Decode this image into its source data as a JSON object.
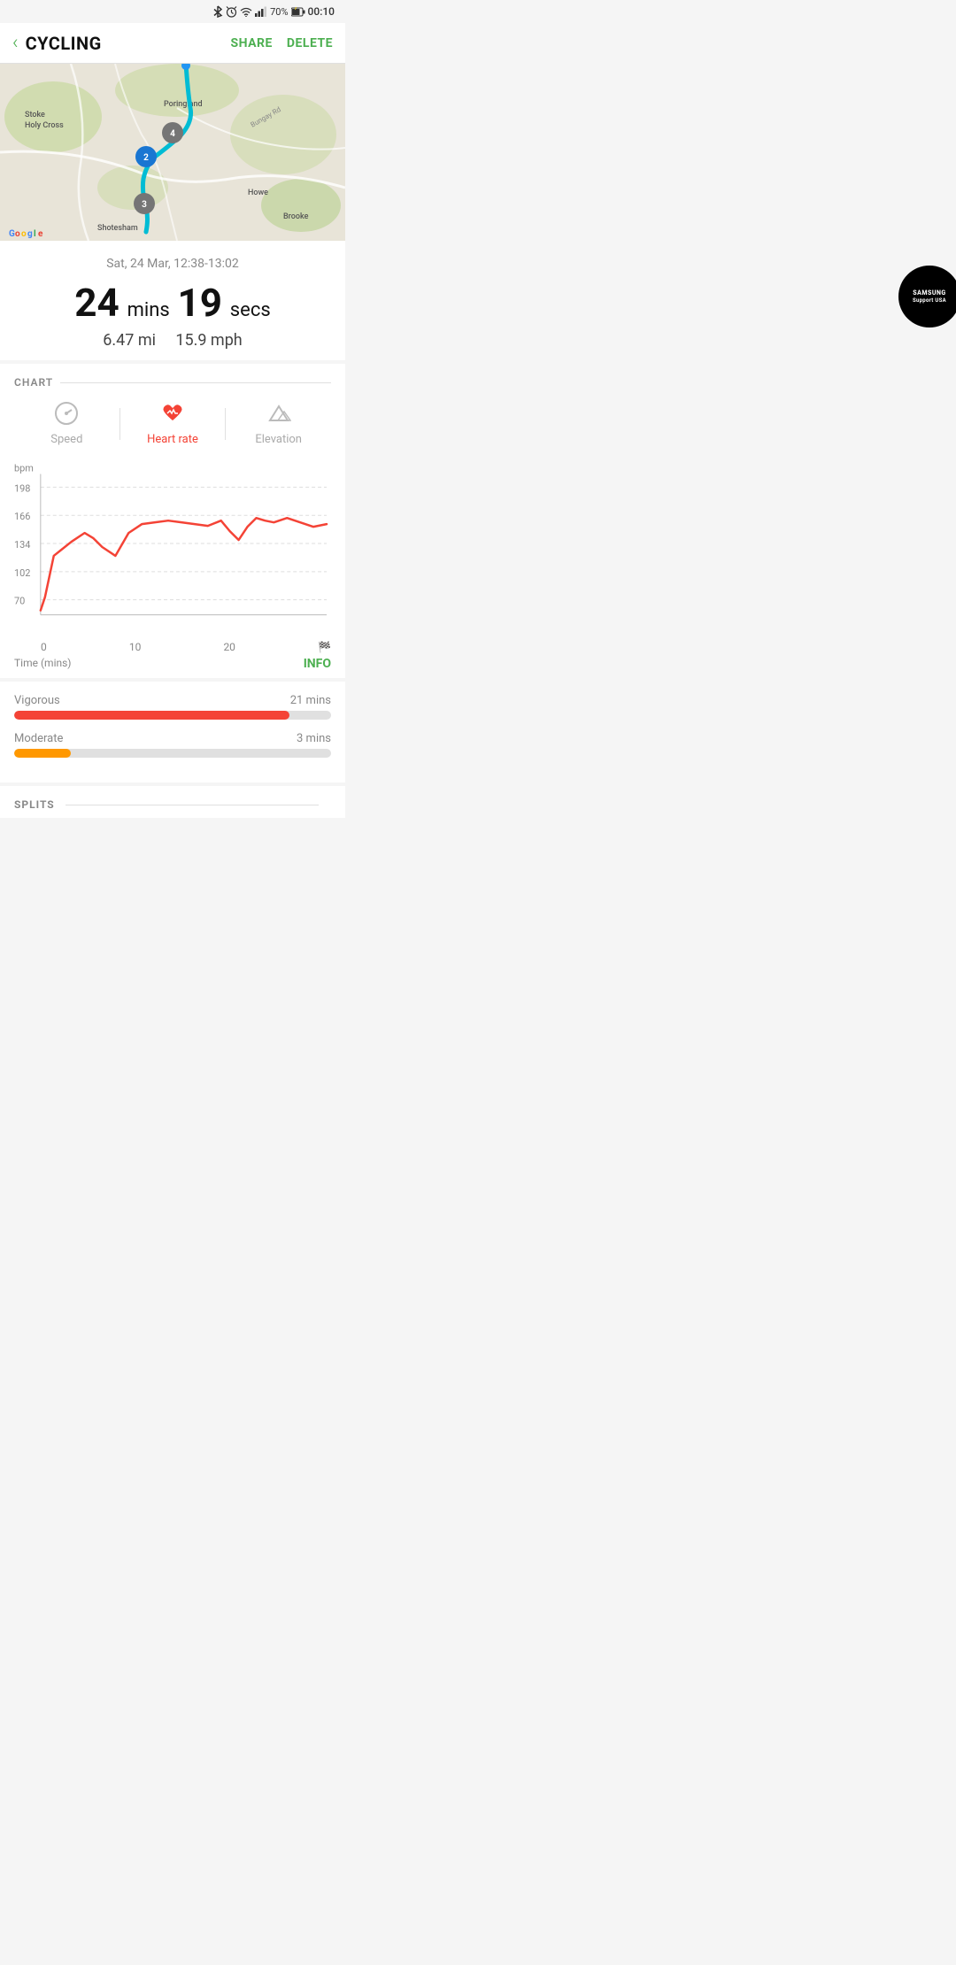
{
  "statusBar": {
    "time": "00:10",
    "battery": "70%",
    "icons": [
      "bluetooth",
      "alarm",
      "wifi",
      "signal"
    ]
  },
  "header": {
    "back_label": "‹",
    "title": "CYCLING",
    "share_label": "SHARE",
    "delete_label": "DELETE"
  },
  "stats": {
    "date": "Sat, 24 Mar, 12:38-13:02",
    "duration_mins": "24",
    "duration_mins_unit": "mins",
    "duration_secs": "19",
    "duration_secs_unit": "secs",
    "distance": "6.47 mi",
    "speed": "15.9 mph"
  },
  "chart": {
    "section_label": "CHART",
    "tabs": [
      {
        "id": "speed",
        "label": "Speed",
        "active": false
      },
      {
        "id": "heart_rate",
        "label": "Heart rate",
        "active": true
      },
      {
        "id": "elevation",
        "label": "Elevation",
        "active": false
      }
    ],
    "y_axis": {
      "unit": "bpm",
      "values": [
        "198",
        "166",
        "134",
        "102",
        "70"
      ]
    },
    "x_axis": {
      "values": [
        "0",
        "10",
        "20"
      ],
      "flag": "🏁",
      "label": "Time (mins)"
    }
  },
  "info": {
    "label": "INFO",
    "rows": [
      {
        "id": "vigorous",
        "label": "Vigorous",
        "value": "21 mins",
        "fill_pct": 87
      },
      {
        "id": "moderate",
        "label": "Moderate",
        "value": "3 mins",
        "fill_pct": 18
      }
    ]
  },
  "splits": {
    "label": "SPLITS"
  },
  "samsung": {
    "line1": "SAMSUNG",
    "line2": "Support USA"
  },
  "map": {
    "places": [
      "Stoke Holy Cross",
      "Poringland",
      "Howe",
      "Brooke",
      "Shotesham"
    ],
    "waypoints": [
      "2",
      "3",
      "4"
    ]
  }
}
